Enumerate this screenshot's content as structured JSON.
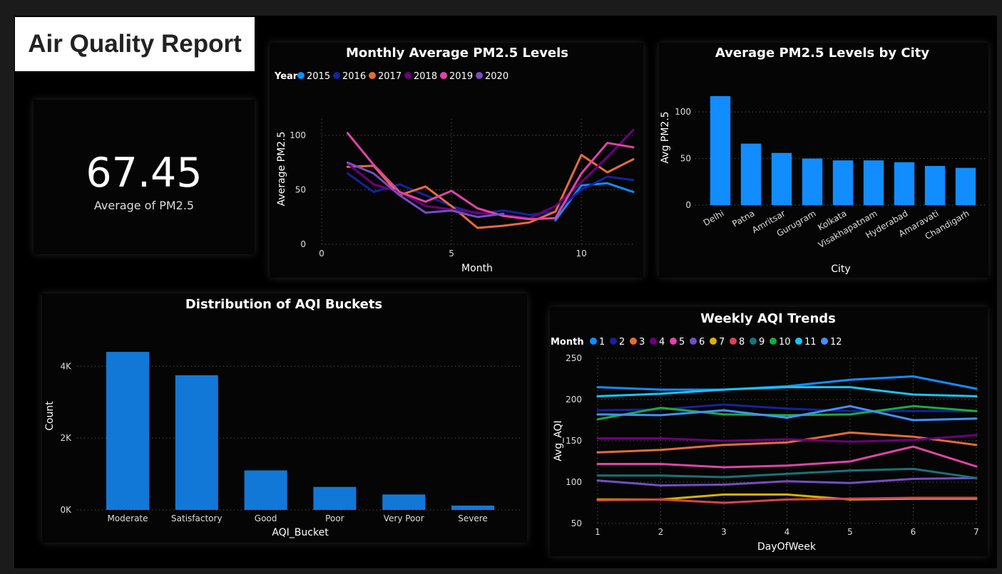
{
  "report_title": "Air Quality Report",
  "kpi": {
    "value": "67.45",
    "label": "Average of PM2.5"
  },
  "colors": {
    "bar": "#118DFF",
    "bar2": "#1278D8",
    "palette": [
      "#118DFF",
      "#12239E",
      "#E66C37",
      "#6B007B",
      "#E044A7",
      "#744EC2",
      "#D9B300",
      "#D64550",
      "#197278",
      "#1AAB40",
      "#15C6F4",
      "#4092FF"
    ]
  },
  "chart_data": [
    {
      "id": "monthly",
      "type": "line",
      "title": "Monthly Average PM2.5 Levels",
      "xlabel": "Month",
      "ylabel": "Average PM2.5",
      "legend_title": "Year",
      "xlim": [
        0,
        12
      ],
      "ylim": [
        0,
        115
      ],
      "xticks": [
        0,
        5,
        10
      ],
      "yticks": [
        0,
        50,
        100
      ],
      "series": [
        {
          "name": "2015",
          "color": "#118DFF",
          "x": [
            9,
            10,
            11,
            12
          ],
          "values": [
            22,
            54,
            56,
            48
          ]
        },
        {
          "name": "2016",
          "color": "#12239E",
          "x": [
            1,
            2,
            3,
            4,
            5,
            6,
            7,
            8,
            9,
            10,
            11,
            12
          ],
          "values": [
            65,
            48,
            55,
            45,
            35,
            28,
            31,
            27,
            30,
            50,
            62,
            59
          ]
        },
        {
          "name": "2017",
          "color": "#E66C37",
          "x": [
            1,
            2,
            3,
            4,
            5,
            6,
            7,
            8,
            9,
            10,
            11,
            12
          ],
          "values": [
            71,
            72,
            45,
            53,
            35,
            15,
            17,
            20,
            30,
            82,
            66,
            78
          ]
        },
        {
          "name": "2018",
          "color": "#6B007B",
          "x": [
            1,
            2,
            3,
            4,
            5,
            6,
            7,
            8,
            9,
            10,
            11,
            12
          ],
          "values": [
            74,
            55,
            48,
            35,
            32,
            29,
            27,
            24,
            35,
            57,
            80,
            105
          ]
        },
        {
          "name": "2019",
          "color": "#E044A7",
          "x": [
            1,
            2,
            3,
            4,
            5,
            6,
            7,
            8,
            9,
            10,
            11,
            12
          ],
          "values": [
            102,
            73,
            48,
            39,
            49,
            33,
            26,
            23,
            24,
            65,
            93,
            89
          ]
        },
        {
          "name": "2020",
          "color": "#744EC2",
          "x": [
            1,
            2,
            3,
            4,
            5,
            6,
            7
          ],
          "values": [
            75,
            65,
            45,
            29,
            31,
            25,
            28
          ]
        }
      ]
    },
    {
      "id": "city",
      "type": "bar",
      "title": "Average PM2.5 Levels by City",
      "xlabel": "City",
      "ylabel": "Avg PM2.5",
      "ylim": [
        0,
        120
      ],
      "yticks": [
        0,
        50,
        100
      ],
      "categories": [
        "Delhi",
        "Patna",
        "Amritsar",
        "Gurugram",
        "Kolkata",
        "Visakhapatnam",
        "Hyderabad",
        "Amaravati",
        "Chandigarh"
      ],
      "values": [
        117,
        66,
        56,
        50,
        48,
        48,
        46,
        42,
        40
      ]
    },
    {
      "id": "aqi",
      "type": "bar",
      "title": "Distribution of AQI Buckets",
      "xlabel": "AQI_Bucket",
      "ylabel": "Count",
      "ylim": [
        0,
        4600
      ],
      "yticks": [
        0,
        2000,
        4000
      ],
      "ytick_labels": [
        "0K",
        "2K",
        "4K"
      ],
      "categories": [
        "Moderate",
        "Satisfactory",
        "Good",
        "Poor",
        "Very Poor",
        "Severe"
      ],
      "values": [
        4400,
        3750,
        1100,
        640,
        430,
        120
      ]
    },
    {
      "id": "weekly",
      "type": "line",
      "title": "Weekly AQI Trends",
      "xlabel": "DayOfWeek",
      "ylabel": "Avg_AQI",
      "legend_title": "Month",
      "xlim": [
        1,
        7
      ],
      "ylim": [
        50,
        250
      ],
      "xticks": [
        1,
        2,
        3,
        4,
        5,
        6,
        7
      ],
      "yticks": [
        50,
        100,
        150,
        200,
        250
      ],
      "x": [
        1,
        2,
        3,
        4,
        5,
        6,
        7
      ],
      "series": [
        {
          "name": "1",
          "color": "#118DFF",
          "values": [
            215,
            212,
            212,
            216,
            224,
            228,
            213
          ]
        },
        {
          "name": "2",
          "color": "#12239E",
          "values": [
            187,
            188,
            194,
            189,
            186,
            186,
            186
          ]
        },
        {
          "name": "3",
          "color": "#E66C37",
          "values": [
            136,
            139,
            145,
            148,
            160,
            155,
            145
          ]
        },
        {
          "name": "4",
          "color": "#6B007B",
          "values": [
            153,
            153,
            150,
            152,
            149,
            151,
            157
          ]
        },
        {
          "name": "5",
          "color": "#E044A7",
          "values": [
            122,
            122,
            118,
            120,
            125,
            143,
            119
          ]
        },
        {
          "name": "6",
          "color": "#744EC2",
          "values": [
            102,
            96,
            97,
            101,
            99,
            104,
            105
          ]
        },
        {
          "name": "7",
          "color": "#D9B300",
          "values": [
            79,
            79,
            85,
            85,
            79,
            80,
            80
          ]
        },
        {
          "name": "8",
          "color": "#D64550",
          "values": [
            78,
            79,
            75,
            79,
            80,
            81,
            81
          ]
        },
        {
          "name": "9",
          "color": "#197278",
          "values": [
            108,
            108,
            106,
            110,
            114,
            116,
            105
          ]
        },
        {
          "name": "10",
          "color": "#1AAB40",
          "values": [
            176,
            190,
            182,
            181,
            182,
            192,
            186
          ]
        },
        {
          "name": "11",
          "color": "#15C6F4",
          "values": [
            204,
            207,
            212,
            215,
            215,
            206,
            204
          ]
        },
        {
          "name": "12",
          "color": "#4092FF",
          "values": [
            182,
            181,
            187,
            178,
            192,
            175,
            177
          ]
        }
      ]
    }
  ]
}
